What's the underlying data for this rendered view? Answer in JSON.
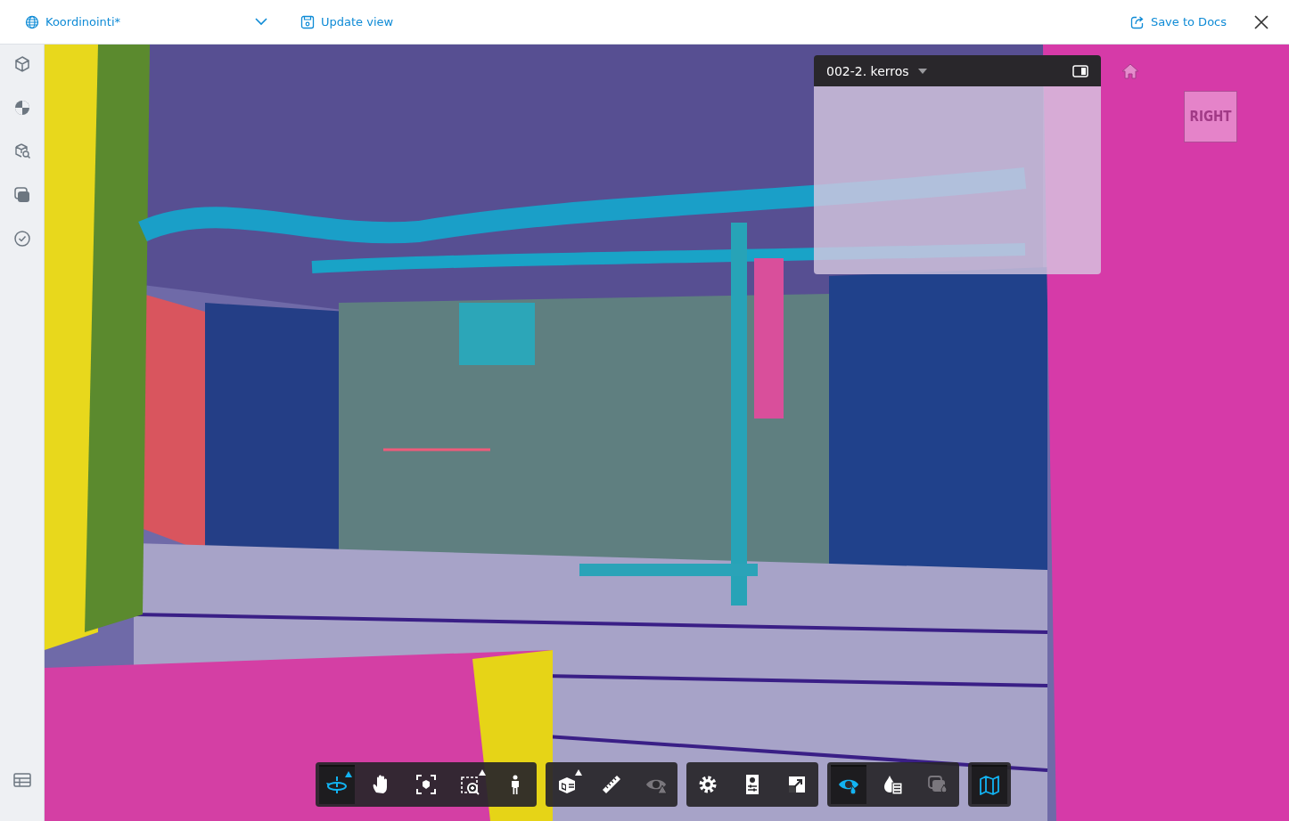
{
  "header": {
    "view_name": "Koordinointi*",
    "update_button": "Update view",
    "save_button": "Save to Docs"
  },
  "sidebar": {
    "items": [
      {
        "kind": "model",
        "selected": false
      },
      {
        "kind": "sheets",
        "selected": false
      },
      {
        "kind": "search",
        "selected": false
      },
      {
        "kind": "layers",
        "selected": false
      },
      {
        "kind": "issues",
        "selected": false
      }
    ],
    "bottom_item": {
      "kind": "table"
    }
  },
  "minimap": {
    "level": "002-2. kerros"
  },
  "view_cube": {
    "face": "RIGHT"
  },
  "toolbar": {
    "groups": [
      [
        {
          "kind": "orbit",
          "selected": true,
          "disabled": false,
          "menu": true
        },
        {
          "kind": "pan",
          "selected": false,
          "disabled": false,
          "menu": false
        },
        {
          "kind": "fit",
          "selected": false,
          "disabled": false,
          "menu": false
        },
        {
          "kind": "zoom",
          "selected": false,
          "disabled": false,
          "menu": true
        },
        {
          "kind": "walk",
          "selected": false,
          "disabled": false,
          "menu": false
        }
      ],
      [
        {
          "kind": "section",
          "selected": false,
          "disabled": false,
          "menu": true
        },
        {
          "kind": "measure",
          "selected": false,
          "disabled": false,
          "menu": false
        },
        {
          "kind": "hide",
          "selected": false,
          "disabled": true,
          "menu": false
        }
      ],
      [
        {
          "kind": "settings",
          "selected": false,
          "disabled": false,
          "menu": false
        },
        {
          "kind": "properties",
          "selected": false,
          "disabled": false,
          "menu": false
        },
        {
          "kind": "fullscreen",
          "selected": false,
          "disabled": false,
          "menu": false
        }
      ],
      [
        {
          "kind": "ghost",
          "selected": true,
          "disabled": false,
          "menu": false
        },
        {
          "kind": "model-browser",
          "selected": false,
          "disabled": false,
          "menu": false
        },
        {
          "kind": "overlay",
          "selected": false,
          "disabled": true,
          "menu": false
        }
      ],
      [
        {
          "kind": "map",
          "selected": true,
          "disabled": false,
          "menu": false
        }
      ]
    ]
  }
}
